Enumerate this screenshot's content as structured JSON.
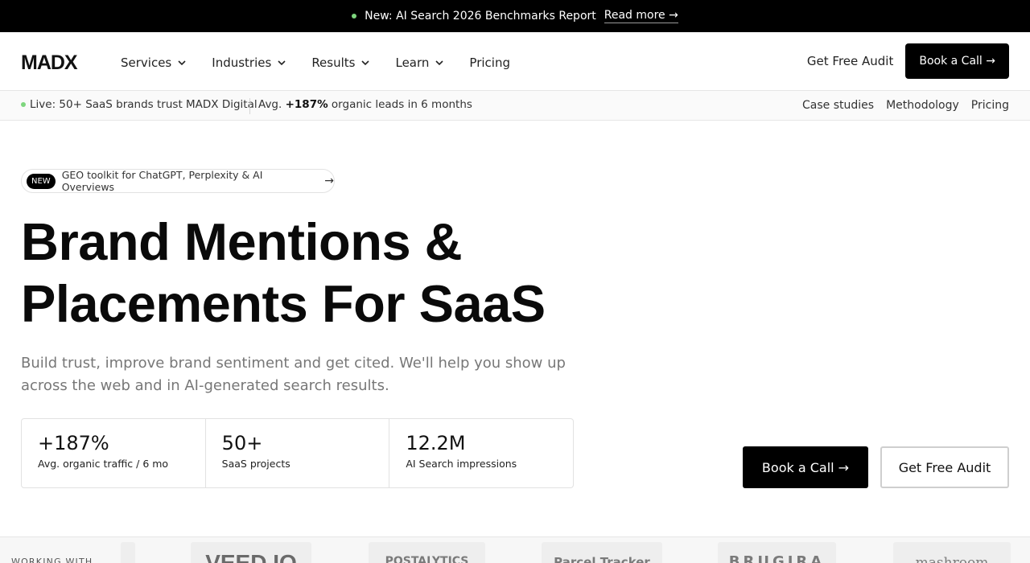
{
  "announcement": {
    "text": "New: AI Search 2026 Benchmarks Report",
    "link": "Read more →"
  },
  "nav": {
    "logo": "MADX",
    "items": [
      {
        "label": "Services",
        "dropdown": true
      },
      {
        "label": "Industries",
        "dropdown": true
      },
      {
        "label": "Results",
        "dropdown": true
      },
      {
        "label": "Learn",
        "dropdown": true
      },
      {
        "label": "Pricing",
        "dropdown": false
      }
    ],
    "audit_label": "Get Free Audit",
    "book_label": "Book a Call →"
  },
  "subbar": {
    "live_text": "Live: 50+ SaaS brands trust MADX Digital",
    "avg_prefix": "Avg.",
    "avg_value": "+187%",
    "avg_suffix": "organic leads in 6 months",
    "links": [
      "Case studies",
      "Methodology",
      "Pricing"
    ]
  },
  "hero": {
    "badge": "NEW",
    "pill_text": "GEO toolkit for ChatGPT, Perplexity & AI Overviews",
    "pill_arrow": "→",
    "headline_line1": "Brand Mentions &",
    "headline_line2": "Placements For SaaS",
    "lead": "Build trust, improve brand sentiment and get cited. We'll help you show up across the web and in AI-generated search results.",
    "stats": [
      {
        "value": "+187%",
        "label": "Avg. organic traffic / 6 mo"
      },
      {
        "value": "50+",
        "label": "SaaS projects"
      },
      {
        "value": "12.2M",
        "label": "AI Search impressions"
      }
    ],
    "cta_book": "Book a Call →",
    "cta_audit": "Get Free Audit"
  },
  "logos": {
    "working_with": "WORKING WITH",
    "items": [
      "",
      "VEED.IO",
      "POSTALYTICS",
      "Parcel Tracker",
      "BRUGIRA",
      "mashroom"
    ]
  },
  "colors": {
    "accent": "#000000",
    "live_dot": "#7ed67e"
  }
}
